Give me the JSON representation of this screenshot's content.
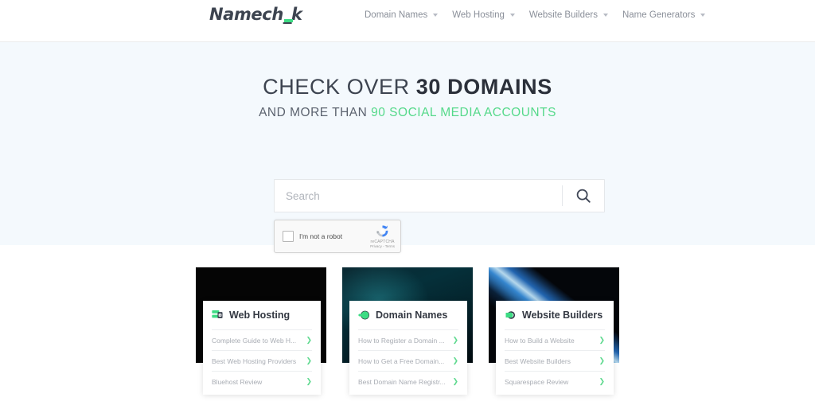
{
  "header": {
    "logo_text_a": "Namech",
    "logo_text_b": "_",
    "logo_text_c": "k",
    "nav": [
      {
        "label": "Domain Names"
      },
      {
        "label": "Web Hosting"
      },
      {
        "label": "Website Builders"
      },
      {
        "label": "Name Generators"
      }
    ]
  },
  "hero": {
    "title_prefix": "CHECK OVER ",
    "title_strong": "30 DOMAINS",
    "sub_prefix": "AND MORE THAN ",
    "sub_green": "90 SOCIAL MEDIA ACCOUNTS",
    "accent_green": "#55d98a",
    "background": "#f4f9fd"
  },
  "search": {
    "value": "",
    "placeholder": "Search",
    "icon": "search-icon"
  },
  "recaptcha": {
    "label": "I'm not a robot",
    "brand": "reCAPTCHA",
    "legal": "Privacy - Terms",
    "checked": false
  },
  "cards": [
    {
      "title": "Web Hosting",
      "icon": "server-lock-icon",
      "image": "green-glow-ring",
      "links": [
        {
          "label": "Complete Guide to Web H..."
        },
        {
          "label": "Best Web Hosting Providers"
        },
        {
          "label": "Bluehost Review"
        }
      ]
    },
    {
      "title": "Domain Names",
      "icon": "domain-globe-icon",
      "image": "teal-nebula",
      "links": [
        {
          "label": "How to Register a Domain ..."
        },
        {
          "label": "How to Get a Free Domain..."
        },
        {
          "label": "Best Domain Name Registr..."
        }
      ]
    },
    {
      "title": "Website Builders",
      "icon": "website-builder-icon",
      "image": "blue-light-streaks",
      "links": [
        {
          "label": "How to Build a Website"
        },
        {
          "label": "Best Website Builders"
        },
        {
          "label": "Squarespace Review"
        }
      ]
    }
  ]
}
